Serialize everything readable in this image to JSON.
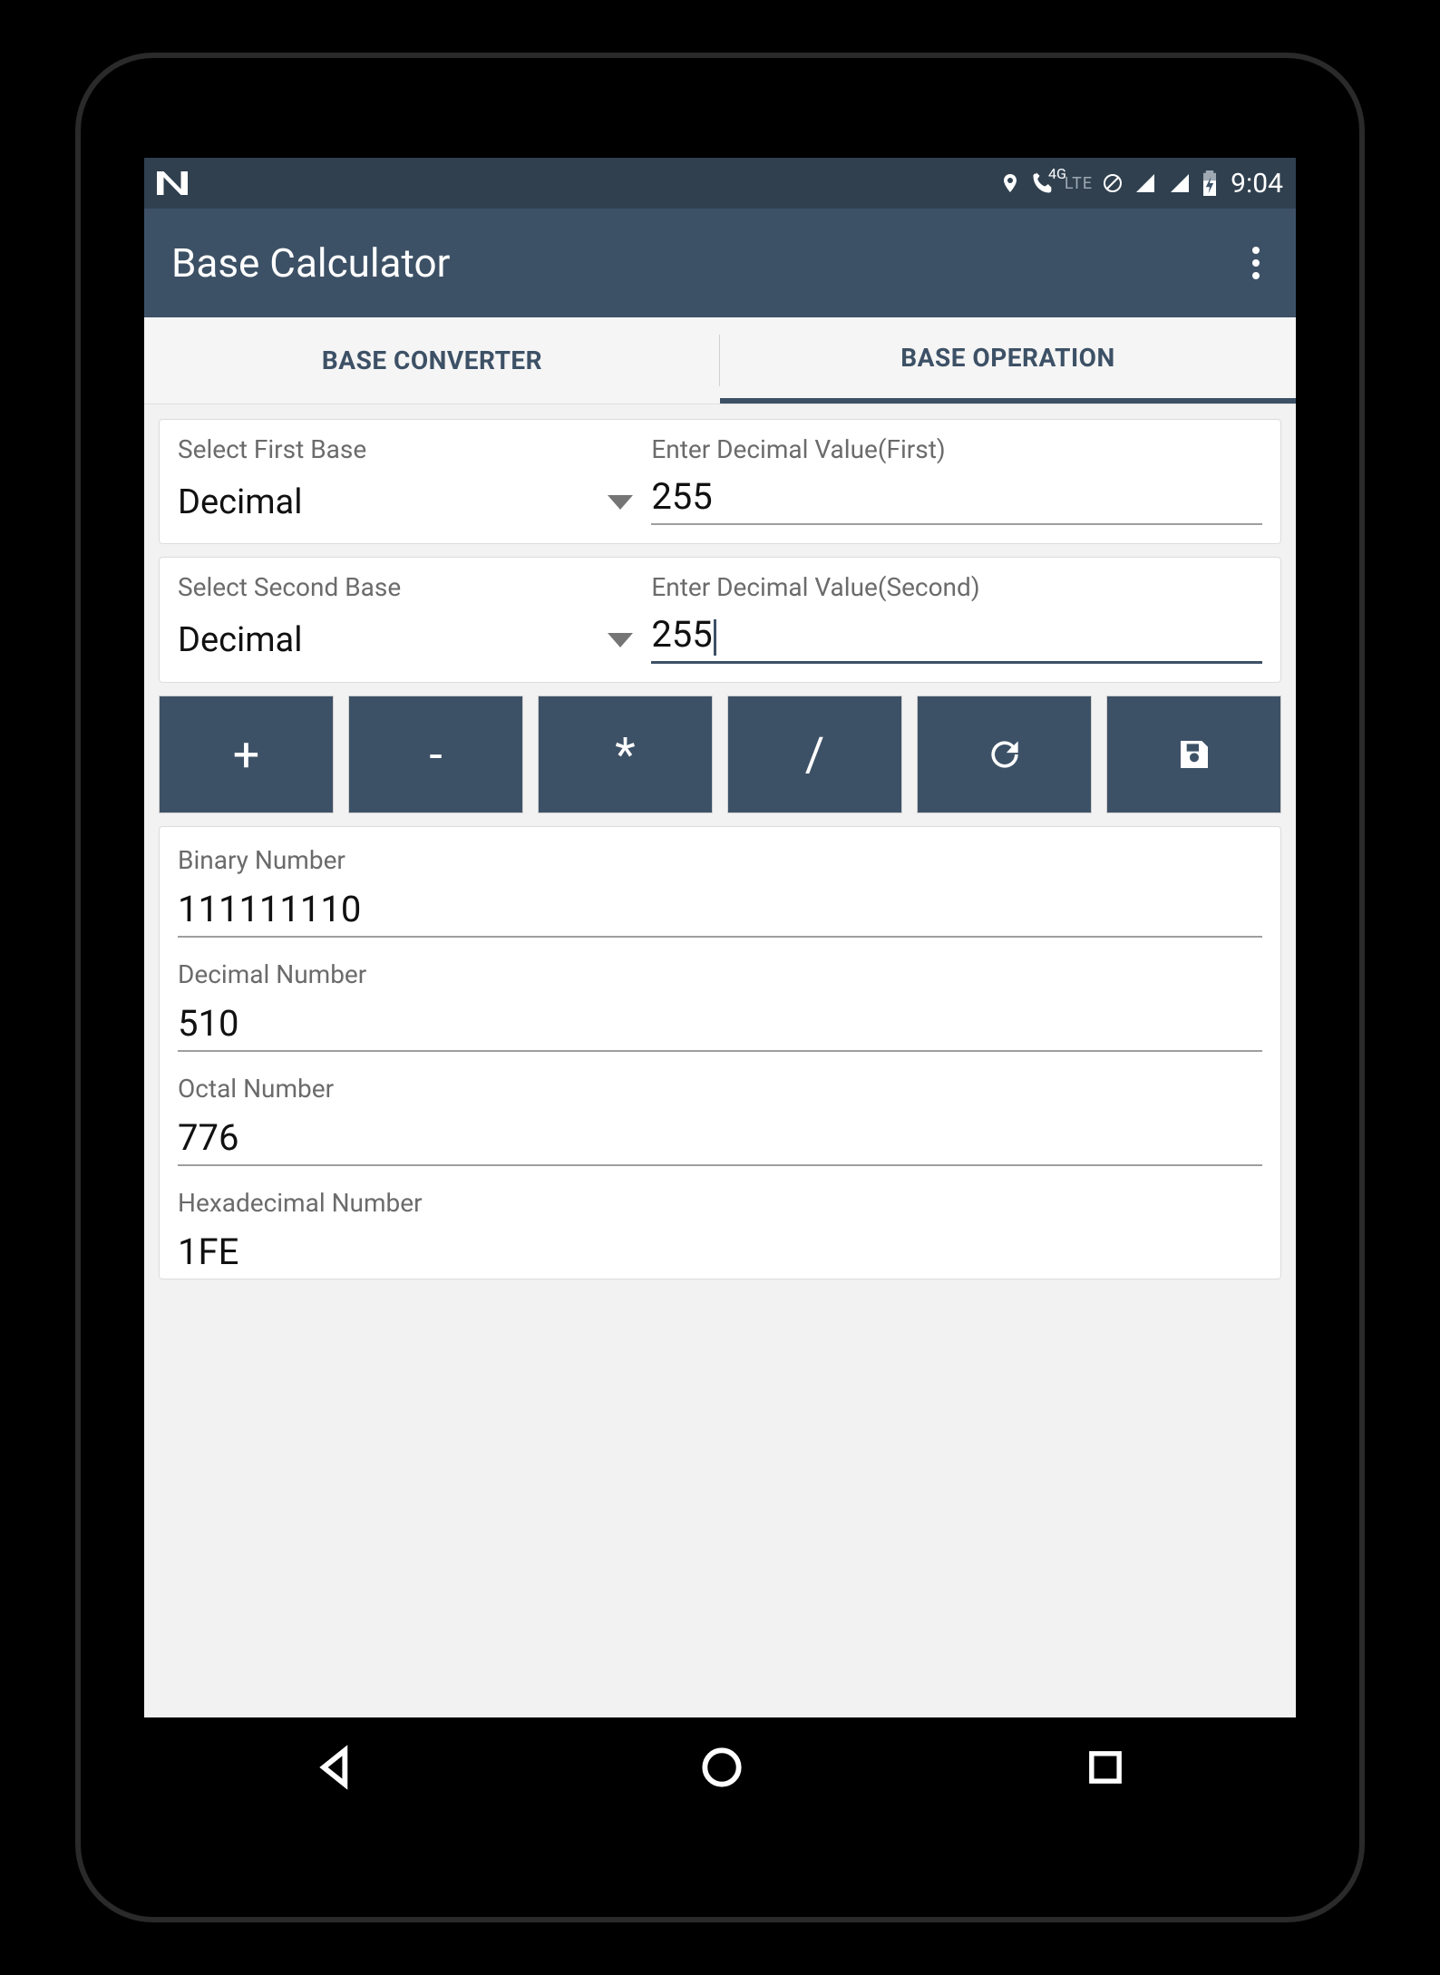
{
  "status": {
    "network": "LTE",
    "fourg": "4G",
    "time": "9:04"
  },
  "appbar": {
    "title": "Base Calculator"
  },
  "tabs": {
    "converter": "BASE CONVERTER",
    "operation": "BASE OPERATION"
  },
  "first": {
    "select_label": "Select First Base",
    "base": "Decimal",
    "input_label": "Enter Decimal Value(First)",
    "value": "255"
  },
  "second": {
    "select_label": "Select Second Base",
    "base": "Decimal",
    "input_label": "Enter Decimal Value(Second)",
    "value": "255"
  },
  "ops": {
    "add": "+",
    "sub": "-",
    "mul": "*",
    "div": "/"
  },
  "results": {
    "binary_label": "Binary Number",
    "binary_value": "111111110",
    "decimal_label": "Decimal Number",
    "decimal_value": "510",
    "octal_label": "Octal Number",
    "octal_value": "776",
    "hex_label": "Hexadecimal Number",
    "hex_value": "1FE"
  }
}
